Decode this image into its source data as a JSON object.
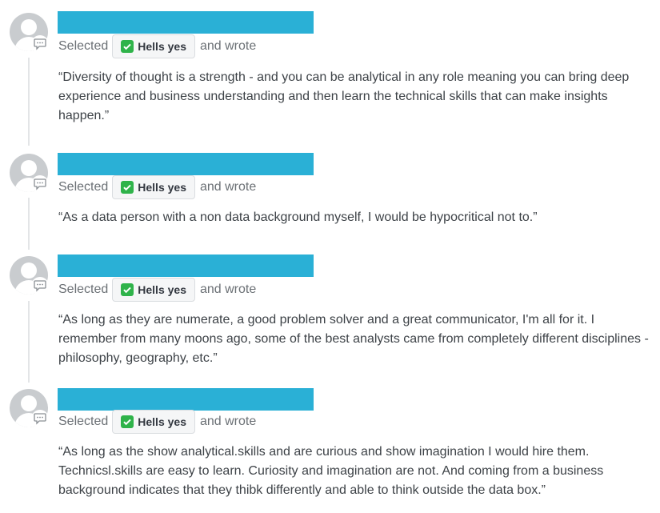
{
  "responses": [
    {
      "selected_label": "Selected",
      "choice": "Hells yes",
      "wrote_label": "and wrote",
      "quote": "“Diversity of thought is a strength - and you can be analytical in any role meaning you can bring deep experience and business understanding and then learn the technical skills that can make insights happen.”"
    },
    {
      "selected_label": "Selected",
      "choice": "Hells yes",
      "wrote_label": "and wrote",
      "quote": "“As a data person with a non data background myself, I would be hypocritical not to.”"
    },
    {
      "selected_label": "Selected",
      "choice": "Hells yes",
      "wrote_label": "and wrote",
      "quote": "“As long as they are numerate, a good problem solver and a great communicator, I'm all for it. I remember from many moons ago, some of the best analysts came from completely different disciplines - philosophy, geography, etc.”"
    },
    {
      "selected_label": "Selected",
      "choice": "Hells yes",
      "wrote_label": "and wrote",
      "quote": "“As long as the show analytical.skills and are curious and show imagination I would hire them. Technicsl.skills are easy to learn. Curiosity and imagination are not. And coming from a business background indicates that they thibk differently and able to think outside the data box.”"
    }
  ],
  "colors": {
    "name_bar": "#2ab0d6",
    "check": "#2fb34a"
  },
  "icons": {
    "avatar": "user-avatar",
    "comment": "speech-bubble-icon",
    "check": "check-mark-icon"
  }
}
